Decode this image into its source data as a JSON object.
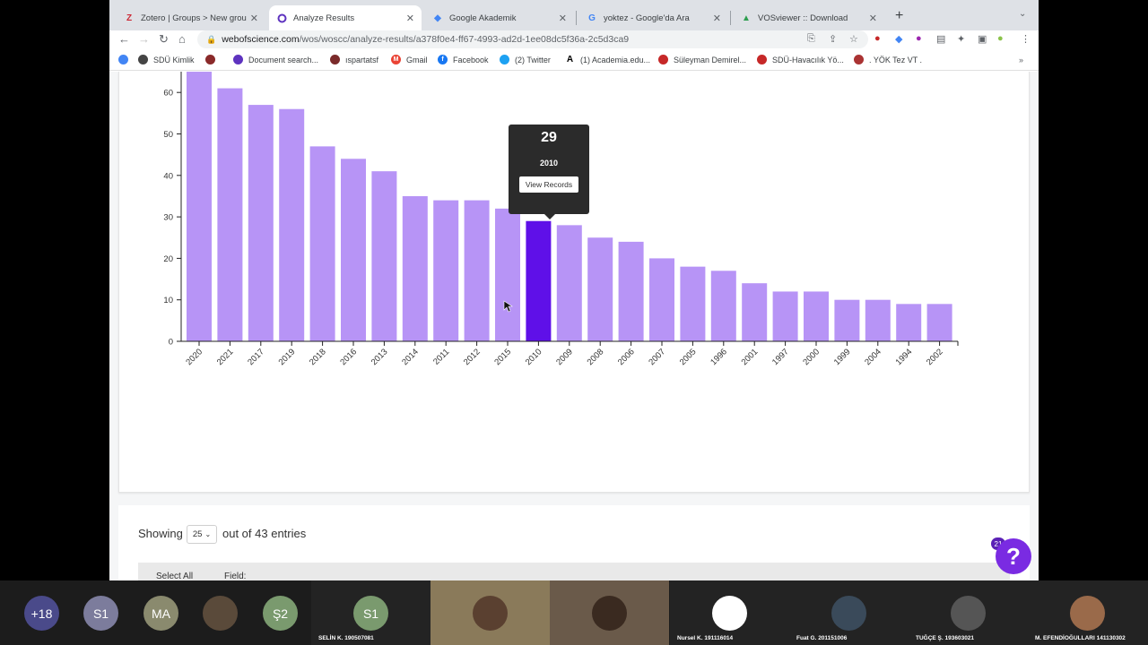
{
  "tabs": [
    {
      "title": "Zotero | Groups > New group",
      "icon": "zotero-icon",
      "active": false
    },
    {
      "title": "Analyze Results",
      "icon": "clarivate-icon",
      "active": true
    },
    {
      "title": "Google Akademik",
      "icon": "scholar-icon",
      "active": false
    },
    {
      "title": "yoktez - Google'da Ara",
      "icon": "google-icon",
      "active": false
    },
    {
      "title": "VOSviewer :: Download",
      "icon": "vosviewer-icon",
      "active": false
    }
  ],
  "address": {
    "domain": "webofscience.com",
    "path": "/wos/woscc/analyze-results/a378f0e4-ff67-4993-ad2d-1ee08dc5f36a-2c5d3ca9"
  },
  "bookmarks": [
    {
      "label": "",
      "icon": "bookmark-logo-icon"
    },
    {
      "label": "SDÜ Kimlik",
      "icon": "globe-icon"
    },
    {
      "label": "",
      "icon": "site-icon"
    },
    {
      "label": "Document search...",
      "icon": "scopus-icon"
    },
    {
      "label": "ıspartatsf",
      "icon": "site-icon"
    },
    {
      "label": "Gmail",
      "icon": "gmail-icon"
    },
    {
      "label": "Facebook",
      "icon": "facebook-icon"
    },
    {
      "label": "(2) Twitter",
      "icon": "twitter-icon"
    },
    {
      "label": "(1) Academia.edu...",
      "icon": "academia-icon"
    },
    {
      "label": "Süleyman Demirel...",
      "icon": "site-icon"
    },
    {
      "label": "SDÜ-Havacılık Yö...",
      "icon": "site-icon"
    },
    {
      "label": ". YÖK Tez VT .",
      "icon": "site-icon"
    }
  ],
  "chart_data": {
    "type": "bar",
    "categories": [
      "2020",
      "2021",
      "2017",
      "2019",
      "2018",
      "2016",
      "2013",
      "2014",
      "2011",
      "2012",
      "2015",
      "2010",
      "2009",
      "2008",
      "2006",
      "2007",
      "2005",
      "1996",
      "2001",
      "1997",
      "2000",
      "1999",
      "2004",
      "1994",
      "2002"
    ],
    "values": [
      65,
      61,
      57,
      56,
      47,
      44,
      41,
      35,
      34,
      34,
      32,
      29,
      28,
      25,
      24,
      20,
      18,
      17,
      14,
      12,
      12,
      10,
      10,
      9,
      9
    ],
    "yticks": [
      "0",
      "10",
      "20",
      "30",
      "40",
      "50",
      "60"
    ],
    "ylim": [
      0,
      66
    ],
    "highlighted_index": 11,
    "bar_color": "#b794f6",
    "highlight_color": "#5f10e8"
  },
  "tooltip": {
    "value": "29",
    "year": "2010",
    "button": "View Records"
  },
  "entries": {
    "prefix": "Showing",
    "page_size": "25",
    "suffix": "out of 43 entries"
  },
  "table_header": {
    "select_all": "Select All",
    "field": "Field:"
  },
  "help": {
    "badge": "21",
    "label": "?"
  },
  "meeting": [
    {
      "initials": "+18",
      "name": "",
      "color": "#4a4a8a"
    },
    {
      "initials": "S1",
      "name": "",
      "color": "#7c7c9c"
    },
    {
      "initials": "MA",
      "name": "",
      "color": "#8a8a6e"
    },
    {
      "initials": "",
      "name": "",
      "color": "#5a4a3a"
    },
    {
      "initials": "Ş2",
      "name": "",
      "color": "#7a9a6e"
    },
    {
      "initials": "S1",
      "name": "SELİN K. 190507081",
      "color": "#7a9a6e"
    },
    {
      "initials": "",
      "name": "",
      "color": "#8a7a5a"
    },
    {
      "initials": "",
      "name": "",
      "color": "#6a5a4a"
    },
    {
      "initials": "",
      "name": "Nursel K. 191116014",
      "color": "#ffffff"
    },
    {
      "initials": "",
      "name": "Fuat G. 201151006",
      "color": "#3a4a5a"
    },
    {
      "initials": "",
      "name": "TUĞÇE Ş. 193603021",
      "color": "#555555"
    },
    {
      "initials": "",
      "name": "M. EFENDİOĞULLARI 141130302",
      "color": "#9a6a4a"
    }
  ]
}
